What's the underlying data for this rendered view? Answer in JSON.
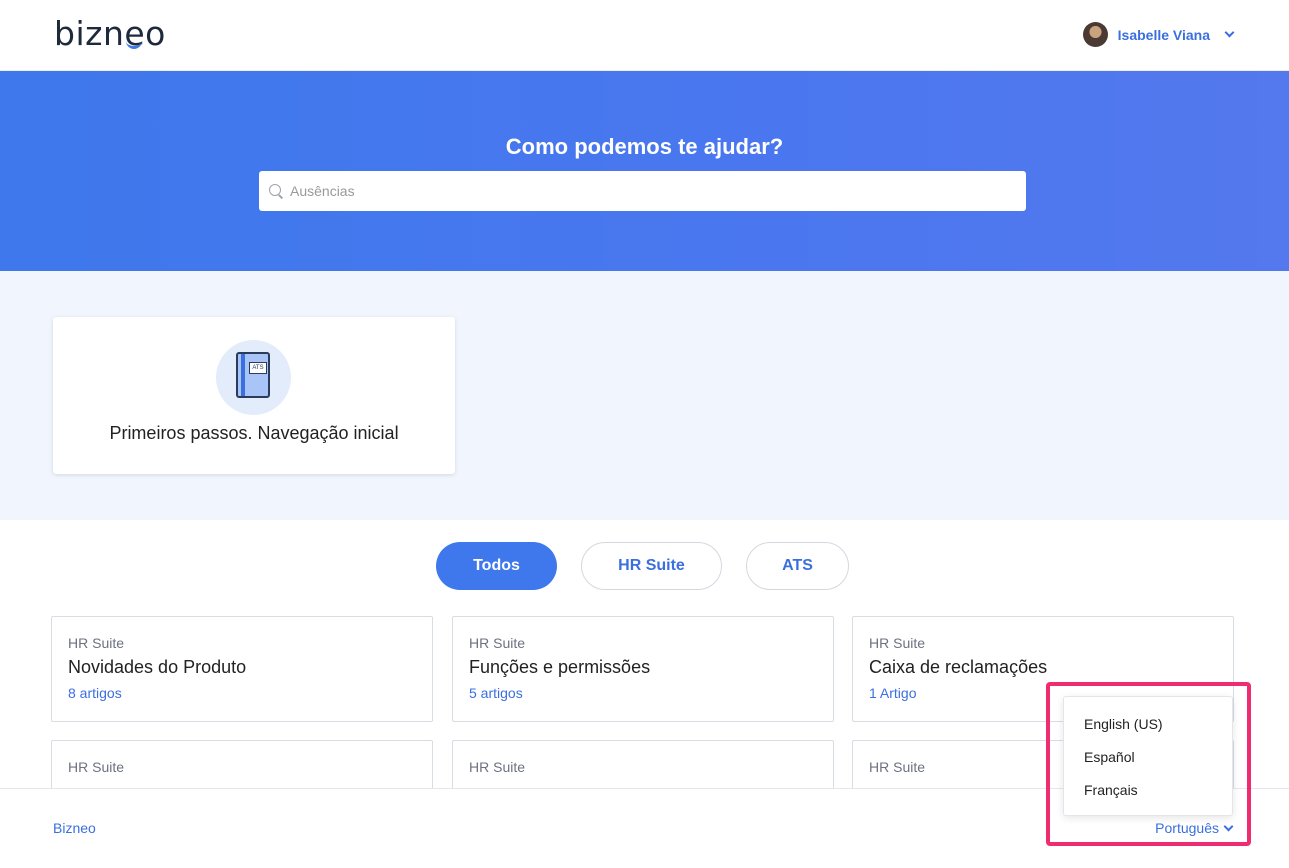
{
  "header": {
    "logo_text_pre": "bizn",
    "logo_text_oe": "e",
    "logo_text_post": "o",
    "user_name": "Isabelle Viana"
  },
  "hero": {
    "title": "Como podemos te ajudar?",
    "search_placeholder": "Ausências",
    "search_icon": "search-icon"
  },
  "featured": {
    "title": "Primeiros passos. Navegação inicial",
    "icon": "book-icon",
    "icon_label": "ATS"
  },
  "tabs": [
    {
      "label": "Todos",
      "active": true
    },
    {
      "label": "HR Suite",
      "active": false
    },
    {
      "label": "ATS",
      "active": false
    }
  ],
  "cards": [
    {
      "tag": "HR Suite",
      "title": "Novidades do Produto",
      "count": "8 artigos"
    },
    {
      "tag": "HR Suite",
      "title": "Funções e permissões",
      "count": "5 artigos"
    },
    {
      "tag": "HR Suite",
      "title": "Caixa de reclamações",
      "count": "1 Artigo"
    },
    {
      "tag": "HR Suite",
      "title": "",
      "count": ""
    },
    {
      "tag": "HR Suite",
      "title": "",
      "count": ""
    },
    {
      "tag": "HR Suite",
      "title": "",
      "count": ""
    }
  ],
  "footer": {
    "link": "Bizneo",
    "language": "Português"
  },
  "language_menu": [
    "English (US)",
    "Español",
    "Français"
  ],
  "colors": {
    "accent": "#3e78ec",
    "link": "#3b6fe0",
    "highlight": "#ee2c6f",
    "band": "#f1f5fd"
  }
}
